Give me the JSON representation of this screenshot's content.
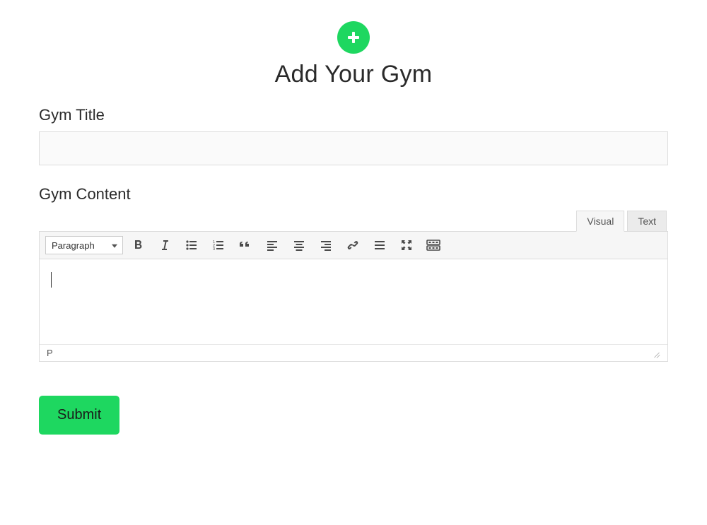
{
  "header": {
    "title": "Add Your Gym"
  },
  "form": {
    "title_label": "Gym Title",
    "title_value": "",
    "content_label": "Gym Content"
  },
  "editor": {
    "tabs": {
      "visual": "Visual",
      "text": "Text",
      "active": "visual"
    },
    "format_select": "Paragraph",
    "content": "",
    "status_path": "P"
  },
  "buttons": {
    "submit": "Submit"
  },
  "colors": {
    "accent": "#1ed760"
  }
}
